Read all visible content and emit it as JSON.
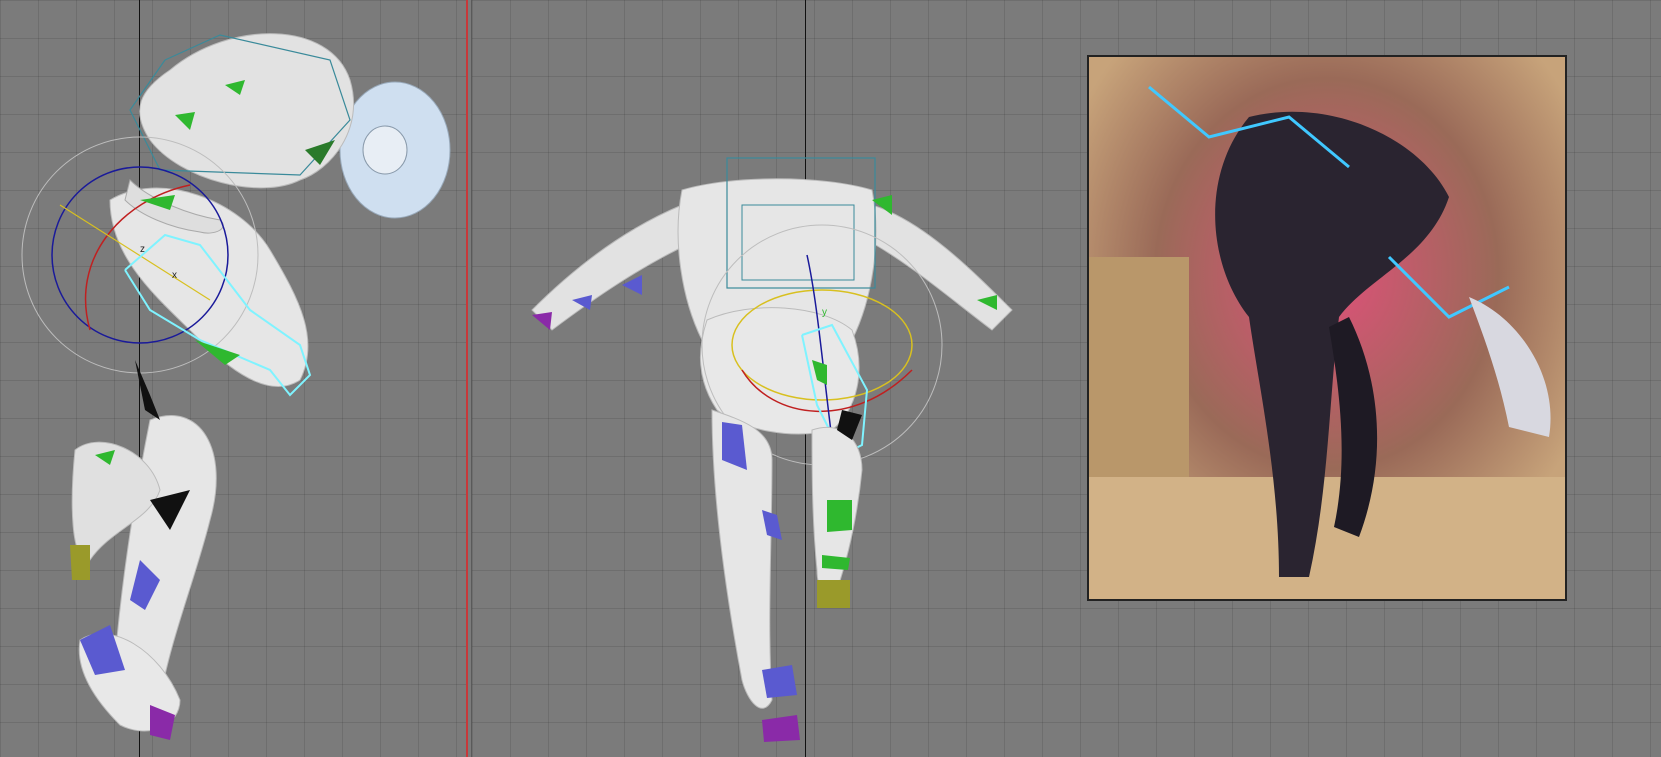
{
  "viewports": [
    {
      "name": "side-viewport",
      "rig": "side-view-character"
    },
    {
      "name": "back-viewport",
      "rig": "back-view-character"
    }
  ],
  "reference": {
    "name": "reference-image"
  },
  "colors": {
    "viewport_bg": "#7b7b7b",
    "grid_line": "#6c6c6c",
    "divider": "#c8383a",
    "mesh": "#e4e4e4",
    "bone_cyan": "#7ff3ff",
    "gizmo_blue": "#1a1a9a",
    "gizmo_red": "#c02020",
    "gizmo_yellow": "#d8c020",
    "marker_green": "#2fb82f",
    "marker_blue": "#5a5ad0",
    "marker_purple": "#8a2aa8",
    "marker_olive": "#9a9a2a"
  },
  "gizmo_labels": {
    "x": "x",
    "y": "y",
    "z": "z"
  }
}
